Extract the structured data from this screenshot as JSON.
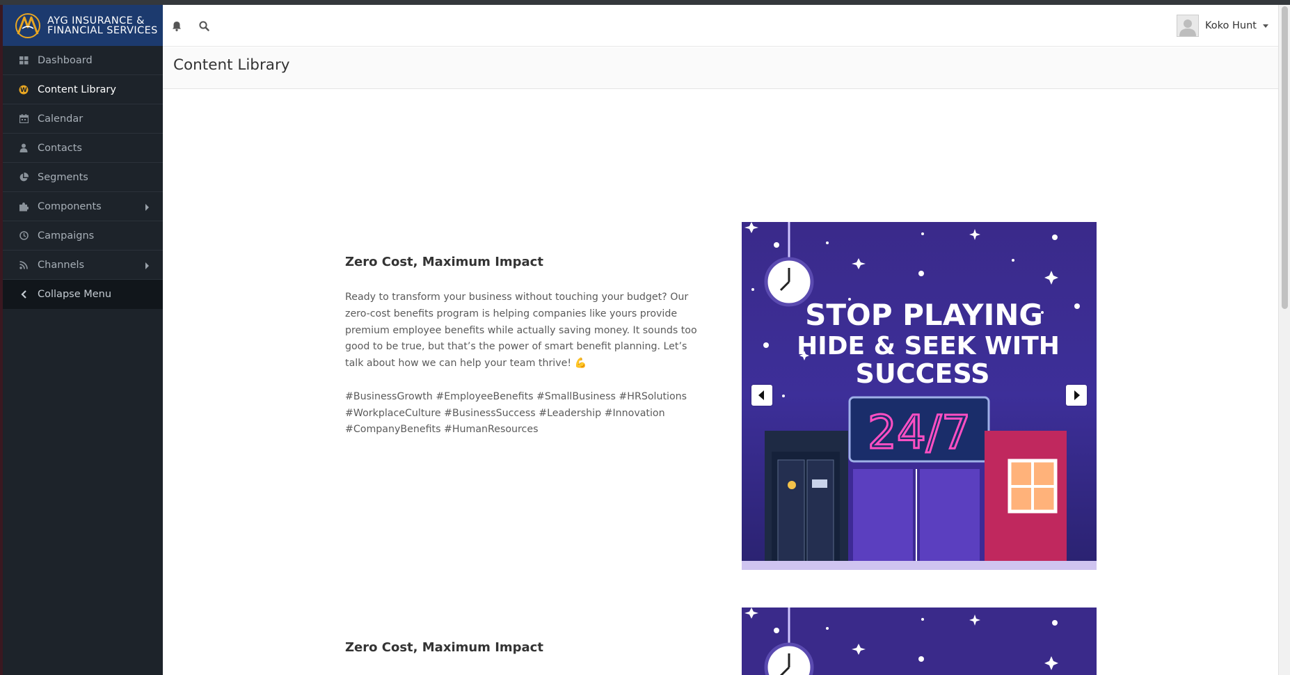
{
  "brand": {
    "line1": "AYG INSURANCE &",
    "line2": "FINANCIAL SERVICES"
  },
  "sidebar": {
    "items": [
      {
        "label": "Dashboard",
        "icon": "dashboard-icon",
        "active": false
      },
      {
        "label": "Content Library",
        "icon": "wordpress-icon",
        "active": true
      },
      {
        "label": "Calendar",
        "icon": "calendar-icon",
        "active": false
      },
      {
        "label": "Contacts",
        "icon": "user-icon",
        "active": false
      },
      {
        "label": "Segments",
        "icon": "pie-chart-icon",
        "active": false
      },
      {
        "label": "Components",
        "icon": "puzzle-icon",
        "active": false,
        "submenu": true
      },
      {
        "label": "Campaigns",
        "icon": "clock-icon",
        "active": false
      },
      {
        "label": "Channels",
        "icon": "rss-icon",
        "active": false,
        "submenu": true
      }
    ],
    "collapse_label": "Collapse Menu"
  },
  "header": {
    "icons": [
      "bell-icon",
      "search-icon"
    ],
    "user_name": "Koko Hunt"
  },
  "page": {
    "title": "Content Library"
  },
  "posts": [
    {
      "title": "Zero Cost, Maximum Impact",
      "body": "Ready to transform your business without touching your budget? Our zero-cost benefits program is helping companies like yours provide premium employee benefits while actually saving money. It sounds too good to be true, but that’s the power of smart benefit planning. Let’s talk about how we can help your team thrive! 💪",
      "tags": "#BusinessGrowth #EmployeeBenefits #SmallBusiness #HRSolutions #WorkplaceCulture #BusinessSuccess #Leadership #Innovation #CompanyBenefits #HumanResources",
      "image": {
        "line1": "STOP PLAYING",
        "line2": "HIDE & SEEK WITH",
        "line3": "SUCCESS",
        "sign": "24/7"
      }
    },
    {
      "title": "Zero Cost, Maximum Impact"
    }
  ],
  "colors": {
    "sidebar_bg": "#1d232a",
    "brand_bg": "#1c3a6e",
    "accent_gold": "#e8a622",
    "neon_pink": "#ff4fc3",
    "poster_purple": "#3b2a8c"
  }
}
